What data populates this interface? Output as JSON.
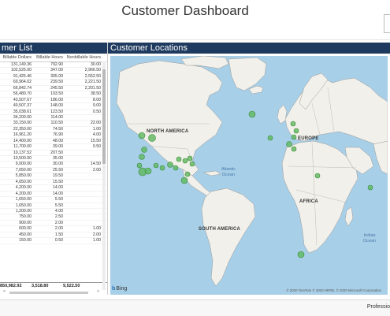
{
  "title": "Customer Dashboard",
  "left_panel": {
    "header": "mer List",
    "columns": [
      "Billable Dollars",
      "Billable Hours",
      "Nonbillable Hours"
    ],
    "rows": [
      [
        "131,149.36",
        "792.90",
        "30.00"
      ],
      [
        "102,525.00",
        "347.00",
        "2,966.50"
      ],
      [
        "91,425.46",
        "305.00",
        "2,552.50"
      ],
      [
        "69,964.02",
        "239.50",
        "2,221.50"
      ],
      [
        "66,842.74",
        "245.50",
        "2,201.50"
      ],
      [
        "56,480.70",
        "193.50",
        "38.50"
      ],
      [
        "43,507.67",
        "186.00",
        "8.00"
      ],
      [
        "40,507.37",
        "148.00",
        "9.00"
      ],
      [
        "35,038.61",
        "123.50",
        "0.50"
      ],
      [
        "34,200.00",
        "114.00",
        ""
      ],
      [
        "33,150.00",
        "110.50",
        "22.00"
      ],
      [
        "22,350.00",
        "74.50",
        "1.00"
      ],
      [
        "16,961.20",
        "76.90",
        "4.00"
      ],
      [
        "14,400.00",
        "48.00",
        "15.50"
      ],
      [
        "11,700.00",
        "39.00",
        "0.50"
      ],
      [
        "10,137.52",
        "207.50",
        ""
      ],
      [
        "10,500.00",
        "35.00",
        ""
      ],
      [
        "9,000.00",
        "30.00",
        "14.50"
      ],
      [
        "7,650.00",
        "25.50",
        "2.00"
      ],
      [
        "5,850.00",
        "19.50",
        ""
      ],
      [
        "4,650.00",
        "15.50",
        ""
      ],
      [
        "4,200.00",
        "14.00",
        ""
      ],
      [
        "4,200.00",
        "14.00",
        ""
      ],
      [
        "1,650.00",
        "5.50",
        ""
      ],
      [
        "1,650.00",
        "5.50",
        ""
      ],
      [
        "1,200.00",
        "4.00",
        ""
      ],
      [
        "750.00",
        "2.50",
        ""
      ],
      [
        "900.00",
        "2.00",
        ""
      ],
      [
        "600.00",
        "2.00",
        "1.00"
      ],
      [
        "450.00",
        "1.50",
        "2.00"
      ],
      [
        "150.00",
        "0.50",
        "1.00"
      ]
    ],
    "total": [
      "850,982.92",
      "3,518.80",
      "9,522.50"
    ]
  },
  "map_panel": {
    "header": "Customer Locations",
    "labels": {
      "north_america": "NORTH AMERICA",
      "south_america": "SOUTH AMERICA",
      "europe": "EUROPE",
      "africa": "AFRICA",
      "atlantic": "Atlantic",
      "atlantic2": "Ocean",
      "indian": "Indian",
      "indian2": "Ocean"
    },
    "bing": "Bing",
    "copyright": "© 2020 TomTom © 2020 HERE, © 2020 Microsoft Corporation",
    "colors": {
      "water": "#a8cfe8",
      "land": "#f2f0ea",
      "border": "#9a9a9a",
      "bubble": "#5cb85c",
      "header": "#1f3a5f"
    }
  },
  "bottom_bar": {
    "text": "Professio"
  }
}
